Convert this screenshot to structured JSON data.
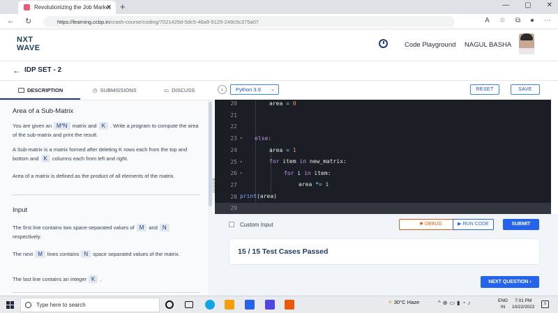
{
  "browser": {
    "tab_title": "Revolutionizing the Job Market",
    "url_host": "https://learning.ccbp.in",
    "url_path": "/crash-course/coding/7021429d-5dc5-46a9-9125-248c5c375a07"
  },
  "header": {
    "logo_line1": "NXT",
    "logo_line2": "WAVE",
    "playground": "Code Playground",
    "user": "NAGUL BASHA"
  },
  "set": {
    "title": "IDP SET - 2"
  },
  "tabs": {
    "description": "DESCRIPTION",
    "submissions": "SUBMISSIONS",
    "discuss": "DISCUSS"
  },
  "problem": {
    "title": "Area of a Sub-Matrix",
    "p1a": "You are given an",
    "p1chip1": "M*N",
    "p1b": "matrix and",
    "p1chip2": "K",
    "p1c": ". Write a program to compute the area of the sub-matrix and print the result.",
    "p2a": "A Sub-matrix is a matrix formed after deleting K rows each from the top and bottom and",
    "p2chip": "K",
    "p2b": "columns each from left and right.",
    "p3": "Area of a matrix is defined as the product of all elements of the matrix.",
    "input_heading": "Input",
    "i1a": "The first line contains two space-separated values of",
    "i1chip1": "M",
    "i1b": "and",
    "i1chip2": "N",
    "i1c": "respectively.",
    "i2a": "The next",
    "i2chip1": "M",
    "i2b": "lines contains",
    "i2chip2": "N",
    "i2c": "space separated values of the matrix.",
    "i3a": "The last line contains an integer",
    "i3chip": "K",
    "i3b": "."
  },
  "editor": {
    "language": "Python 3.9",
    "reset": "RESET",
    "save": "SAVE",
    "lines": [
      {
        "n": "20",
        "fold": ""
      },
      {
        "n": "21",
        "fold": ""
      },
      {
        "n": "22",
        "fold": ""
      },
      {
        "n": "23",
        "fold": "▾"
      },
      {
        "n": "24",
        "fold": ""
      },
      {
        "n": "25",
        "fold": "▾"
      },
      {
        "n": "26",
        "fold": "▾"
      },
      {
        "n": "27",
        "fold": ""
      },
      {
        "n": "28",
        "fold": ""
      },
      {
        "n": "29",
        "fold": ""
      }
    ],
    "tokens": {
      "area": "area",
      "eq": "=",
      "zero": "0",
      "else": "else:",
      "one": "1",
      "for": "for",
      "item": "item",
      "in": "in",
      "new_matrix": "new_matrix:",
      "i": "i",
      "item_colon": "item:",
      "mul_eq": "*=",
      "print": "print",
      "print_arg": "(area)"
    }
  },
  "console": {
    "custom_input": "Custom Input",
    "debug": "DEBUG",
    "run_code": "RUN CODE",
    "submit": "SUBMIT",
    "result": "15 / 15 Test Cases Passed",
    "next": "NEXT QUESTION"
  },
  "taskbar": {
    "search_placeholder": "Type here to search",
    "weather": "30°C  Haze",
    "lang_line1": "ENG",
    "lang_line2": "IN",
    "time": "7:01 PM",
    "date": "10/22/2022"
  }
}
